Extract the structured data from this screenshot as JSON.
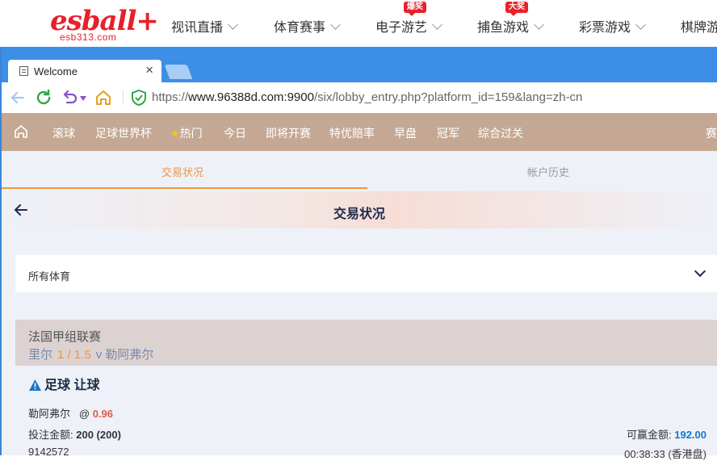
{
  "site": {
    "logo_text": "esball+",
    "logo_sub": "esb313.com",
    "nav": [
      {
        "label": "视讯直播",
        "badge": ""
      },
      {
        "label": "体育赛事",
        "badge": ""
      },
      {
        "label": "电子游艺",
        "badge": "爆奖"
      },
      {
        "label": "捕鱼游戏",
        "badge": "大奖"
      },
      {
        "label": "彩票游戏",
        "badge": ""
      },
      {
        "label": "棋牌游",
        "badge": ""
      }
    ]
  },
  "browser": {
    "tab_title": "Welcome",
    "url_scheme": "https://",
    "url_host": "www.96388d.com:9900",
    "url_path": "/six/lobby_entry.php?platform_id=159&lang=zh-cn"
  },
  "sport_nav": [
    "滚球",
    "足球世界杯",
    "热门",
    "今日",
    "即将开赛",
    "特优赔率",
    "早盘",
    "冠军",
    "综合过关",
    "赛"
  ],
  "tabs": {
    "active": "交易状况",
    "inactive": "帐户历史"
  },
  "page_title": "交易状况",
  "filter": {
    "selected": "所有体育"
  },
  "bet": {
    "league": "法国甲组联赛",
    "home": "里尔",
    "handicap": "1 / 1.5",
    "vs": "v",
    "away": "勒阿弗尔",
    "type": "足球 让球",
    "selection": "勒阿弗尔",
    "at": "@",
    "odds": "0.96",
    "stake_label": "投注金额:",
    "stake_value": "200 (200)",
    "win_label": "可赢金额:",
    "win_value": "192.00",
    "ref_no": "9142572",
    "time": "00:38:33 (香港盘)"
  },
  "colors": {
    "brand_red": "#e8202a",
    "tab_blue": "#3d8ee6",
    "sport_nav": "#c5a893",
    "accent_orange": "#f0963c",
    "win_blue": "#1a75c9"
  }
}
